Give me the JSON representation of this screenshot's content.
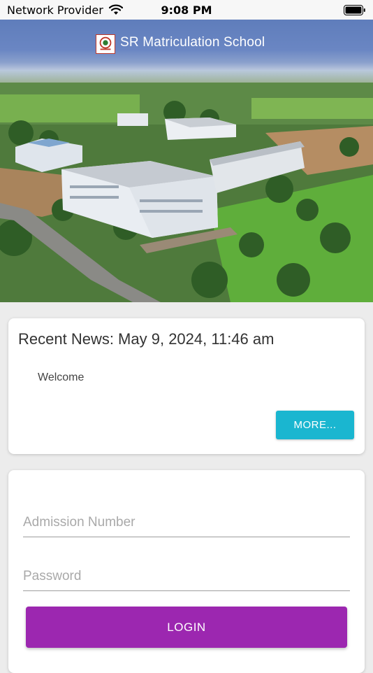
{
  "status_bar": {
    "carrier": "Network Provider",
    "time": "9:08 PM",
    "wifi_icon": "wifi-icon",
    "battery_icon": "battery-icon"
  },
  "header": {
    "title": "SR Matriculation School",
    "logo_icon": "school-logo-icon",
    "color": "#6a86c3"
  },
  "hero": {
    "image": "aerial-campus-photo"
  },
  "news": {
    "title": "Recent News: May 9, 2024, 11:46 am",
    "text": "Welcome",
    "more_label": "MORE...",
    "button_color": "#1ab6d0"
  },
  "login": {
    "admission_placeholder": "Admission Number",
    "admission_value": "",
    "password_placeholder": "Password",
    "password_value": "",
    "login_label": "LOGIN",
    "button_color": "#9c27b0"
  }
}
